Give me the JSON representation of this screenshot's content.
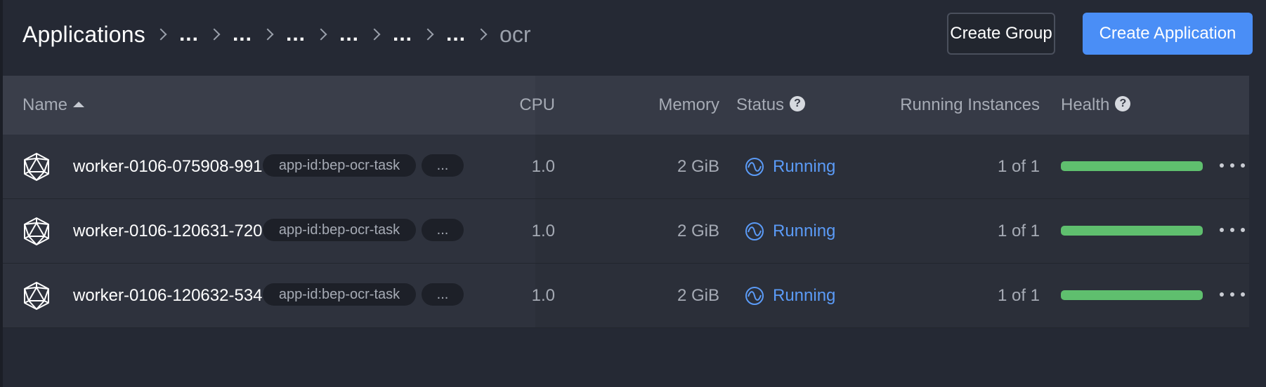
{
  "breadcrumb": {
    "root": "Applications",
    "collapsed": [
      "...",
      "...",
      "...",
      "...",
      "...",
      "..."
    ],
    "current": "ocr"
  },
  "toolbar": {
    "create_group_label": "Create Group",
    "create_application_label": "Create Application"
  },
  "table": {
    "columns": {
      "name": "Name",
      "cpu": "CPU",
      "memory": "Memory",
      "status": "Status",
      "running_instances": "Running Instances",
      "health": "Health"
    },
    "rows": [
      {
        "name": "worker-0106-075908-991",
        "tag": "app-id:bep-ocr-task",
        "more_tags": "...",
        "cpu": "1.0",
        "memory": "2 GiB",
        "status": "Running",
        "instances": "1 of 1",
        "health_fraction": 1.0
      },
      {
        "name": "worker-0106-120631-720",
        "tag": "app-id:bep-ocr-task",
        "more_tags": "...",
        "cpu": "1.0",
        "memory": "2 GiB",
        "status": "Running",
        "instances": "1 of 1",
        "health_fraction": 1.0
      },
      {
        "name": "worker-0106-120632-534",
        "tag": "app-id:bep-ocr-task",
        "more_tags": "...",
        "cpu": "1.0",
        "memory": "2 GiB",
        "status": "Running",
        "instances": "1 of 1",
        "health_fraction": 1.0
      }
    ]
  },
  "colors": {
    "primary": "#4a8ef6",
    "status_running": "#5b9bf7",
    "health_ok": "#5fbf6e",
    "background": "#252934"
  },
  "icons": {
    "app": "polyhedron-icon",
    "status": "running-wave-icon",
    "help": "help-circle-icon",
    "sort": "sort-ascending-icon",
    "row_menu": "more-horizontal-icon",
    "breadcrumb_separator": "chevron-right-icon"
  }
}
